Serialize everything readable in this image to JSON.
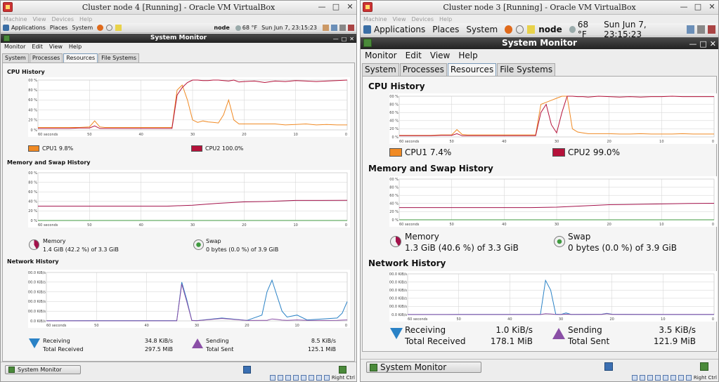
{
  "left": {
    "window_title": "Cluster node 4 [Running] - Oracle VM VirtualBox",
    "vbox_menu": [
      "Machine",
      "View",
      "Devices",
      "Help"
    ],
    "panel": {
      "menus": [
        "Applications",
        "Places",
        "System"
      ],
      "hostname": "node",
      "weather": "68 °F",
      "clock": "Sun Jun  7, 23:15:23"
    },
    "app_title": "System Monitor",
    "app_menu": [
      "Monitor",
      "Edit",
      "View",
      "Help"
    ],
    "tabs": [
      "System",
      "Processes",
      "Resources",
      "File Systems"
    ],
    "active_tab": "Resources",
    "cpu": {
      "title": "CPU History",
      "y_ticks": [
        "100 %",
        "80 %",
        "60 %",
        "40 %",
        "20 %",
        "0 %"
      ],
      "x_ticks": [
        "60 seconds",
        "50",
        "40",
        "30",
        "20",
        "10",
        "0"
      ],
      "cpu1_label": "CPU1  9.8%",
      "cpu2_label": "CPU2  100.0%"
    },
    "mem": {
      "title": "Memory and Swap History",
      "y_ticks": [
        "100 %",
        "80 %",
        "60 %",
        "40 %",
        "20 %",
        "0 %"
      ],
      "x_ticks": [
        "60 seconds",
        "50",
        "40",
        "30",
        "20",
        "10",
        "0"
      ],
      "memory_label": "Memory",
      "memory_value": "1.4 GiB (42.2 %) of 3.3 GiB",
      "swap_label": "Swap",
      "swap_value": "0 bytes (0.0 %) of 3.9 GiB"
    },
    "net": {
      "title": "Network History",
      "y_ticks": [
        "500.0 KiB/s",
        "400.0 KiB/s",
        "300.0 KiB/s",
        "200.0 KiB/s",
        "100.0 KiB/s",
        "0.0 KiB/s"
      ],
      "x_ticks": [
        "60 seconds",
        "50",
        "40",
        "30",
        "20",
        "10",
        "0"
      ],
      "receiving_label": "Receiving",
      "receiving_value": "34.8 KiB/s",
      "total_received_label": "Total Received",
      "total_received_value": "297.5 MiB",
      "sending_label": "Sending",
      "sending_value": "8.5 KiB/s",
      "total_sent_label": "Total Sent",
      "total_sent_value": "125.1 MiB"
    },
    "taskbar_button": "System Monitor",
    "host_key": "Right Ctrl"
  },
  "right": {
    "window_title": "Cluster node 3 [Running] - Oracle VM VirtualBox",
    "vbox_menu": [
      "Machine",
      "View",
      "Devices",
      "Help"
    ],
    "panel": {
      "menus": [
        "Applications",
        "Places",
        "System"
      ],
      "hostname": "node",
      "weather": "68 °F",
      "clock": "Sun Jun  7, 23:15:23"
    },
    "app_title": "System Monitor",
    "app_menu": [
      "Monitor",
      "Edit",
      "View",
      "Help"
    ],
    "tabs": [
      "System",
      "Processes",
      "Resources",
      "File Systems"
    ],
    "active_tab": "Resources",
    "cpu": {
      "title": "CPU History",
      "y_ticks": [
        "100 %",
        "80 %",
        "60 %",
        "40 %",
        "20 %",
        "0 %"
      ],
      "x_ticks": [
        "60 seconds",
        "50",
        "40",
        "30",
        "20",
        "10",
        "0"
      ],
      "cpu1_label": "CPU1  7.4%",
      "cpu2_label": "CPU2  99.0%"
    },
    "mem": {
      "title": "Memory and Swap History",
      "y_ticks": [
        "100 %",
        "80 %",
        "60 %",
        "40 %",
        "20 %",
        "0 %"
      ],
      "x_ticks": [
        "60 seconds",
        "50",
        "40",
        "30",
        "20",
        "10",
        "0"
      ],
      "memory_label": "Memory",
      "memory_value": "1.3 GiB (40.6 %) of 3.3 GiB",
      "swap_label": "Swap",
      "swap_value": "0 bytes (0.0 %) of 3.9 GiB"
    },
    "net": {
      "title": "Network History",
      "y_ticks": [
        "500.0 KiB/s",
        "400.0 KiB/s",
        "300.0 KiB/s",
        "200.0 KiB/s",
        "100.0 KiB/s",
        "0.0 KiB/s"
      ],
      "x_ticks": [
        "60 seconds",
        "50",
        "40",
        "30",
        "20",
        "10",
        "0"
      ],
      "receiving_label": "Receiving",
      "receiving_value": "1.0 KiB/s",
      "total_received_label": "Total Received",
      "total_received_value": "178.1 MiB",
      "sending_label": "Sending",
      "sending_value": "3.5 KiB/s",
      "total_sent_label": "Total Sent",
      "total_sent_value": "121.9 MiB"
    },
    "taskbar_button": "System Monitor",
    "host_key": "Right Ctrl"
  },
  "colors": {
    "cpu1": "#f08a24",
    "cpu2": "#b5123a",
    "memory": "#a3124b",
    "swap": "#3f9a3f",
    "receiving": "#2a82c6",
    "sending": "#8a4fa6",
    "grid": "#d2d2d2"
  },
  "chart_data": [
    {
      "type": "line",
      "title": "CPU History",
      "window": "Cluster node 4",
      "x": [
        60,
        58,
        56,
        54,
        52,
        50,
        49,
        48,
        47,
        46,
        44,
        42,
        40,
        38,
        36,
        34,
        33,
        32,
        31,
        30,
        29,
        28,
        27,
        26,
        25,
        24,
        23,
        22,
        21,
        20,
        18,
        16,
        14,
        12,
        10,
        8,
        6,
        4,
        2,
        0
      ],
      "x_reversed": true,
      "ylim": [
        0,
        100
      ],
      "series": [
        {
          "name": "CPU1",
          "values": [
            5,
            5,
            5,
            5,
            5,
            6,
            18,
            6,
            5,
            5,
            5,
            5,
            5,
            5,
            5,
            5,
            80,
            90,
            60,
            20,
            15,
            18,
            16,
            15,
            14,
            30,
            60,
            20,
            12,
            12,
            12,
            12,
            12,
            10,
            11,
            12,
            10,
            11,
            10,
            10
          ]
        },
        {
          "name": "CPU2",
          "values": [
            3,
            3,
            3,
            3,
            4,
            4,
            8,
            3,
            3,
            3,
            3,
            3,
            3,
            3,
            3,
            3,
            70,
            85,
            95,
            100,
            100,
            99,
            99,
            100,
            100,
            99,
            98,
            100,
            96,
            97,
            98,
            95,
            98,
            97,
            99,
            98,
            97,
            98,
            99,
            100
          ]
        }
      ]
    },
    {
      "type": "line",
      "title": "Memory and Swap History",
      "window": "Cluster node 4",
      "x": [
        60,
        50,
        40,
        35,
        30,
        25,
        20,
        15,
        10,
        5,
        0
      ],
      "x_reversed": true,
      "ylim": [
        0,
        100
      ],
      "series": [
        {
          "name": "Memory",
          "values": [
            30,
            30,
            30,
            30,
            32,
            36,
            39,
            40,
            42,
            42,
            42.2
          ]
        },
        {
          "name": "Swap",
          "values": [
            0,
            0,
            0,
            0,
            0,
            0,
            0,
            0,
            0,
            0,
            0
          ]
        }
      ]
    },
    {
      "type": "line",
      "title": "Network History",
      "window": "Cluster node 4",
      "x": [
        60,
        50,
        40,
        34,
        33,
        32,
        31,
        30,
        25,
        20,
        17,
        16,
        15,
        14,
        13,
        12,
        10,
        8,
        5,
        2,
        1,
        0
      ],
      "x_reversed": true,
      "ylim": [
        0,
        500
      ],
      "series": [
        {
          "name": "Receiving",
          "values": [
            2,
            3,
            3,
            3,
            400,
            220,
            5,
            3,
            30,
            5,
            60,
            300,
            420,
            260,
            100,
            40,
            60,
            10,
            20,
            30,
            80,
            200
          ]
        },
        {
          "name": "Sending",
          "values": [
            1,
            1,
            1,
            1,
            380,
            200,
            4,
            2,
            25,
            4,
            5,
            6,
            20,
            15,
            8,
            5,
            10,
            5,
            4,
            5,
            8,
            10
          ]
        }
      ]
    },
    {
      "type": "line",
      "title": "CPU History",
      "window": "Cluster node 3",
      "x": [
        60,
        58,
        56,
        54,
        52,
        50,
        49,
        48,
        47,
        46,
        44,
        42,
        40,
        38,
        36,
        34,
        33,
        32,
        31,
        30,
        29,
        28,
        27,
        26,
        25,
        24,
        22,
        20,
        18,
        16,
        14,
        12,
        10,
        8,
        6,
        4,
        2,
        0
      ],
      "x_reversed": true,
      "ylim": [
        0,
        100
      ],
      "series": [
        {
          "name": "CPU1",
          "values": [
            4,
            4,
            4,
            4,
            5,
            5,
            18,
            6,
            5,
            5,
            5,
            5,
            5,
            5,
            5,
            5,
            80,
            85,
            90,
            95,
            100,
            100,
            20,
            12,
            10,
            8,
            8,
            8,
            7,
            7,
            8,
            7,
            7,
            7,
            8,
            7,
            7,
            7
          ]
        },
        {
          "name": "CPU2",
          "values": [
            3,
            3,
            3,
            3,
            4,
            4,
            8,
            3,
            3,
            3,
            3,
            3,
            3,
            3,
            3,
            3,
            60,
            80,
            30,
            10,
            60,
            100,
            100,
            99,
            99,
            98,
            100,
            99,
            98,
            99,
            98,
            99,
            99,
            100,
            99,
            99,
            99,
            99
          ]
        }
      ]
    },
    {
      "type": "line",
      "title": "Memory and Swap History",
      "window": "Cluster node 3",
      "x": [
        60,
        50,
        40,
        35,
        30,
        25,
        20,
        15,
        10,
        5,
        0
      ],
      "x_reversed": true,
      "ylim": [
        0,
        100
      ],
      "series": [
        {
          "name": "Memory",
          "values": [
            30,
            30,
            30,
            30,
            31,
            34,
            37,
            38,
            39,
            40,
            40.6
          ]
        },
        {
          "name": "Swap",
          "values": [
            0,
            0,
            0,
            0,
            0,
            0,
            0,
            0,
            0,
            0,
            0
          ]
        }
      ]
    },
    {
      "type": "line",
      "title": "Network History",
      "window": "Cluster node 3",
      "x": [
        60,
        50,
        40,
        34,
        33,
        32,
        31,
        30,
        29,
        28,
        22,
        21,
        20,
        15,
        10,
        5,
        0
      ],
      "x_reversed": true,
      "ylim": [
        0,
        500
      ],
      "series": [
        {
          "name": "Receiving",
          "values": [
            1,
            2,
            2,
            2,
            420,
            300,
            5,
            2,
            20,
            3,
            4,
            15,
            4,
            2,
            1,
            1,
            1
          ]
        },
        {
          "name": "Sending",
          "values": [
            1,
            1,
            1,
            1,
            10,
            8,
            2,
            1,
            5,
            2,
            3,
            12,
            3,
            2,
            2,
            3,
            3
          ]
        }
      ]
    }
  ]
}
